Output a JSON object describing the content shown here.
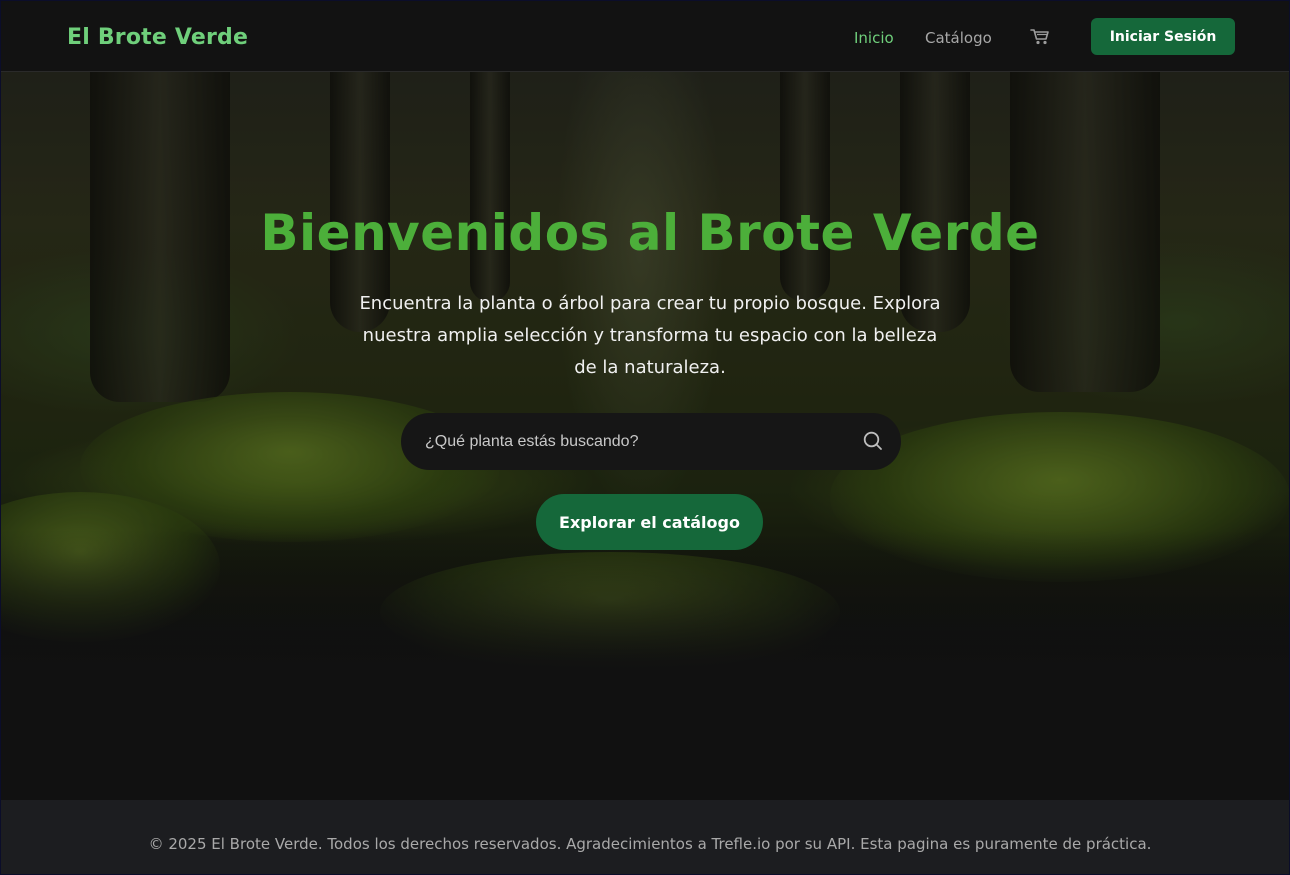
{
  "header": {
    "brand": "El Brote Verde",
    "nav": {
      "inicio": "Inicio",
      "catalogo": "Catálogo",
      "cart_icon": "shopping-cart-icon"
    },
    "login_label": "Iniciar Sesión"
  },
  "hero": {
    "title": "Bienvenidos al Brote Verde",
    "subtitle": "Encuentra la planta o árbol para crear tu propio bosque. Explora nuestra amplia selección y transforma tu espacio con la belleza de la naturaleza.",
    "search": {
      "placeholder": "¿Qué planta estás buscando?",
      "value": "",
      "icon": "search-icon"
    },
    "cta_label": "Explorar el catálogo"
  },
  "footer": {
    "text": "© 2025 El Brote Verde. Todos los derechos reservados. Agradecimientos a Trefle.io por su API. Esta pagina es puramente de práctica."
  },
  "colors": {
    "accent_green": "#4caf3a",
    "brand_green": "#6fcf7b",
    "button_green": "#15683a",
    "background": "#111111",
    "footer_bg": "#1c1d20"
  }
}
